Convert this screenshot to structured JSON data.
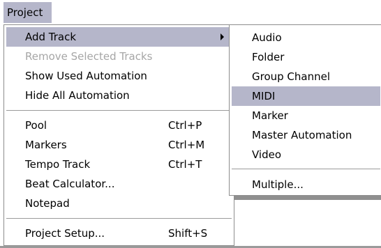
{
  "menubar": {
    "project_label": "Project"
  },
  "menu": {
    "items": [
      {
        "label": "Add Track",
        "shortcut": ""
      },
      {
        "label": "Remove Selected Tracks",
        "shortcut": ""
      },
      {
        "label": "Show Used Automation",
        "shortcut": ""
      },
      {
        "label": "Hide All Automation",
        "shortcut": ""
      },
      {
        "label": "Pool",
        "shortcut": "Ctrl+P"
      },
      {
        "label": "Markers",
        "shortcut": "Ctrl+M"
      },
      {
        "label": "Tempo Track",
        "shortcut": "Ctrl+T"
      },
      {
        "label": "Beat Calculator...",
        "shortcut": ""
      },
      {
        "label": "Notepad",
        "shortcut": ""
      },
      {
        "label": "Project Setup...",
        "shortcut": "Shift+S"
      }
    ]
  },
  "submenu": {
    "items": [
      {
        "label": "Audio"
      },
      {
        "label": "Folder"
      },
      {
        "label": "Group Channel"
      },
      {
        "label": "MIDI"
      },
      {
        "label": "Marker"
      },
      {
        "label": "Master Automation"
      },
      {
        "label": "Video"
      },
      {
        "label": "Multiple..."
      }
    ]
  },
  "colors": {
    "highlight": "#b5b6ca",
    "disabled_text": "#a6a6a6",
    "border": "#8d8d8d"
  },
  "icons": {
    "submenu_arrow": "chevron-right-icon"
  }
}
